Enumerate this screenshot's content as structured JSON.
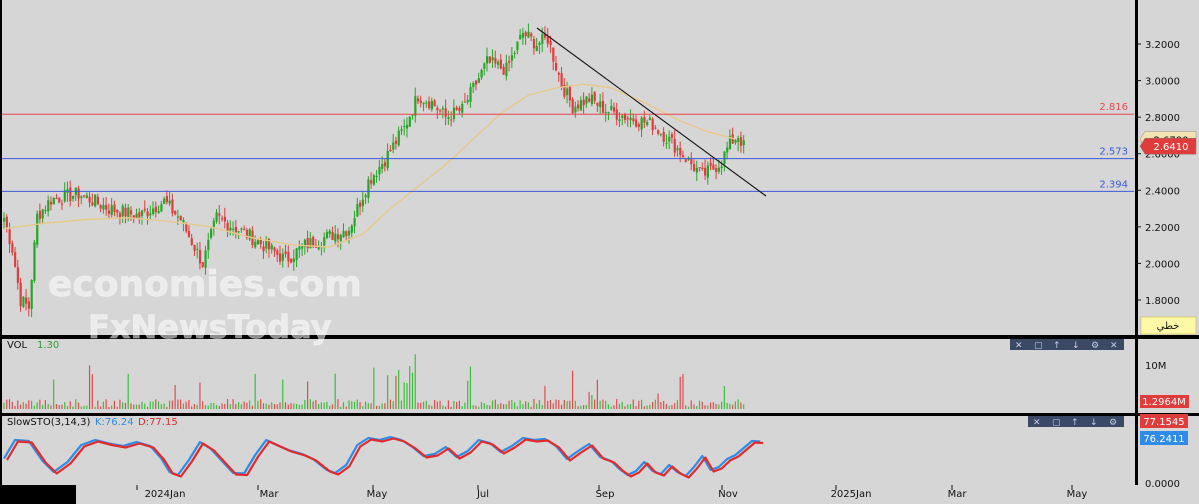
{
  "chart_data": [
    {
      "type": "candlestick",
      "y_ticks": [
        "3.2000",
        "3.0000",
        "2.8000",
        "2.6000",
        "2.4000",
        "2.2000",
        "2.0000",
        "1.8000"
      ],
      "ylim": [
        1.68,
        3.33
      ],
      "x_ticks": [
        "2024Jan",
        "Mar",
        "May",
        "Jul",
        "Sep",
        "Nov",
        "2025Jan",
        "Mar",
        "May"
      ],
      "horizontal_lines": [
        {
          "label": "2.816",
          "value": 2.816,
          "color": "#e8474d"
        },
        {
          "label": "2.573",
          "value": 2.573,
          "color": "#3b5bdb"
        },
        {
          "label": "2.394",
          "value": 2.394,
          "color": "#3b5bdb"
        }
      ],
      "trendline": {
        "from": [
          3.29,
          "late Jul"
        ],
        "to": [
          2.38,
          "early Nov"
        ]
      },
      "moving_average": true,
      "price_tags": [
        {
          "label": "2.6780",
          "value": 2.678,
          "bg": "#f3e3b0",
          "fg": "#000000"
        },
        {
          "label": "2.6410",
          "value": 2.641,
          "bg": "#e03c3c",
          "fg": "#ffffff"
        }
      ],
      "button_label": "خطي",
      "watermark": [
        "economies.com",
        "FxNewsToday"
      ],
      "key_points": [
        [
          0,
          2.25
        ],
        [
          3,
          2.08
        ],
        [
          6,
          1.8
        ],
        [
          9,
          1.76
        ],
        [
          12,
          2.26
        ],
        [
          17,
          2.35
        ],
        [
          27,
          2.38
        ],
        [
          38,
          2.3
        ],
        [
          49,
          2.26
        ],
        [
          58,
          2.34
        ],
        [
          64,
          2.24
        ],
        [
          72,
          2.0
        ],
        [
          77,
          2.25
        ],
        [
          88,
          2.16
        ],
        [
          102,
          2.02
        ],
        [
          109,
          2.1
        ],
        [
          116,
          2.14
        ],
        [
          125,
          2.19
        ],
        [
          132,
          2.45
        ],
        [
          138,
          2.57
        ],
        [
          145,
          2.74
        ],
        [
          150,
          2.92
        ],
        [
          155,
          2.88
        ],
        [
          160,
          2.8
        ],
        [
          166,
          2.84
        ],
        [
          175,
          3.1
        ],
        [
          182,
          3.06
        ],
        [
          188,
          3.26
        ],
        [
          193,
          3.2
        ],
        [
          197,
          3.23
        ],
        [
          202,
          2.98
        ],
        [
          206,
          2.86
        ],
        [
          212,
          2.9
        ],
        [
          218,
          2.84
        ],
        [
          226,
          2.8
        ],
        [
          235,
          2.76
        ],
        [
          242,
          2.66
        ],
        [
          248,
          2.56
        ],
        [
          253,
          2.48
        ],
        [
          257,
          2.52
        ],
        [
          260,
          2.56
        ],
        [
          263,
          2.66
        ],
        [
          266,
          2.7
        ],
        [
          268,
          2.64
        ]
      ],
      "ma_points": [
        [
          0,
          2.19
        ],
        [
          15,
          2.22
        ],
        [
          30,
          2.24
        ],
        [
          45,
          2.25
        ],
        [
          60,
          2.23
        ],
        [
          75,
          2.2
        ],
        [
          90,
          2.14
        ],
        [
          105,
          2.1
        ],
        [
          118,
          2.09
        ],
        [
          130,
          2.16
        ],
        [
          140,
          2.3
        ],
        [
          150,
          2.42
        ],
        [
          160,
          2.54
        ],
        [
          170,
          2.68
        ],
        [
          180,
          2.82
        ],
        [
          190,
          2.92
        ],
        [
          200,
          2.96
        ],
        [
          210,
          2.98
        ],
        [
          220,
          2.96
        ],
        [
          232,
          2.88
        ],
        [
          245,
          2.78
        ],
        [
          255,
          2.72
        ],
        [
          265,
          2.68
        ]
      ]
    },
    {
      "type": "bar",
      "label": "VOL",
      "value_label": "1.30",
      "y_tick": "10M",
      "tag": "1.2964M"
    },
    {
      "type": "line",
      "label": "SlowSTO(3,14,3)",
      "k_label": "K:76.24",
      "d_label": "D:77.15",
      "tags": [
        "77.1545",
        "76.2411"
      ],
      "y_tick": "0.0000",
      "ylim": [
        0,
        100
      ],
      "k_points": [
        [
          0,
          45
        ],
        [
          4,
          82
        ],
        [
          9,
          80
        ],
        [
          14,
          40
        ],
        [
          18,
          18
        ],
        [
          23,
          38
        ],
        [
          28,
          72
        ],
        [
          33,
          82
        ],
        [
          38,
          75
        ],
        [
          43,
          70
        ],
        [
          48,
          78
        ],
        [
          53,
          70
        ],
        [
          57,
          45
        ],
        [
          60,
          18
        ],
        [
          63,
          12
        ],
        [
          67,
          42
        ],
        [
          71,
          78
        ],
        [
          75,
          64
        ],
        [
          79,
          40
        ],
        [
          83,
          16
        ],
        [
          87,
          15
        ],
        [
          91,
          52
        ],
        [
          95,
          82
        ],
        [
          99,
          72
        ],
        [
          103,
          62
        ],
        [
          108,
          54
        ],
        [
          112,
          44
        ],
        [
          117,
          22
        ],
        [
          120,
          16
        ],
        [
          124,
          32
        ],
        [
          128,
          72
        ],
        [
          132,
          86
        ],
        [
          136,
          82
        ],
        [
          140,
          88
        ],
        [
          144,
          82
        ],
        [
          148,
          68
        ],
        [
          152,
          50
        ],
        [
          156,
          54
        ],
        [
          160,
          68
        ],
        [
          164,
          48
        ],
        [
          168,
          60
        ],
        [
          172,
          82
        ],
        [
          176,
          76
        ],
        [
          180,
          58
        ],
        [
          184,
          70
        ],
        [
          188,
          86
        ],
        [
          192,
          82
        ],
        [
          196,
          84
        ],
        [
          200,
          70
        ],
        [
          204,
          44
        ],
        [
          208,
          60
        ],
        [
          212,
          74
        ],
        [
          216,
          48
        ],
        [
          220,
          40
        ],
        [
          223,
          24
        ],
        [
          226,
          12
        ],
        [
          229,
          20
        ],
        [
          232,
          38
        ],
        [
          235,
          20
        ],
        [
          238,
          14
        ],
        [
          241,
          32
        ],
        [
          244,
          18
        ],
        [
          247,
          10
        ],
        [
          250,
          28
        ],
        [
          253,
          50
        ],
        [
          256,
          22
        ],
        [
          259,
          28
        ],
        [
          262,
          44
        ],
        [
          265,
          52
        ],
        [
          268,
          66
        ],
        [
          271,
          80
        ],
        [
          274,
          79
        ]
      ]
    }
  ],
  "colors": {
    "up": "#26a626",
    "down": "#e03c3c",
    "bg": "#d6d6d6",
    "ma": "#e8c88a",
    "k": "#2f8be6",
    "d": "#e22a2a"
  },
  "toolbar_icons": [
    "close-icon",
    "window-icon",
    "up-arrow-icon",
    "down-arrow-icon",
    "settings-icon",
    "close-icon"
  ]
}
